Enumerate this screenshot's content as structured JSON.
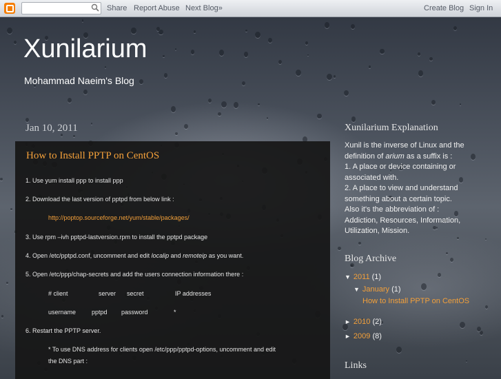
{
  "navbar": {
    "logo_icon": "blogger-logo-icon",
    "search_placeholder": "",
    "links": [
      "Share",
      "Report Abuse",
      "Next Blog»"
    ],
    "right_links": [
      "Create Blog",
      "Sign In"
    ]
  },
  "header": {
    "title": "Xunilarium",
    "description": "Mohammad Naeim's Blog"
  },
  "post": {
    "date": "Jan 10, 2011",
    "title": "How to Install PPTP on CentOS",
    "lines": {
      "l1": "1. Use  yum install ppp to install ppp",
      "l2": "2. Download the last version of pptpd  from below link :",
      "link": "http://poptop.sourceforge.net/yum/stable/packages/",
      "l3": "3. Use rpm –ivh pptpd-lastversion.rpm to install the pptpd package",
      "l4a": "4. Open /etc/pptpd.conf, uncomment and edit ",
      "l4b": "localip",
      "l4c": " and ",
      "l4d": "remoteip",
      "l4e": " as you want.",
      "l5": "5. Open /etc/ppp/chap-secrets and add the users connection information there :",
      "table_head": [
        "# client",
        "server",
        "secret",
        "IP addresses"
      ],
      "table_row": [
        "username",
        "pptpd",
        "password",
        "*"
      ],
      "l6": "6. Restart the PPTP server.",
      "l7a": "* To use DNS address for clients open /etc/ppp/pptpd-options, uncomment and edit",
      "l7b": "the DNS part :"
    }
  },
  "sidebar": {
    "explanation_title": "Xunilarium Explanation",
    "explanation_p1a": "Xunil is the inverse of Linux and the definition of ",
    "explanation_p1b": "arium",
    "explanation_p1c": " as a suffix is :",
    "explanation_lines": [
      "1. A place or device containing or associated with.",
      "2. A place to view and understand something about a certain topic.",
      "Also it's the abbreviation of :",
      "Addiction, Resources, Information, Utilization, Mission."
    ],
    "archive_title": "Blog Archive",
    "archive": {
      "y2011": "2011",
      "y2011_count": "(1)",
      "jan": "January",
      "jan_count": "(1)",
      "post": "How to Install PPTP on CentOS",
      "y2010": "2010",
      "y2010_count": "(2)",
      "y2009": "2009",
      "y2009_count": "(8)"
    },
    "links_title": "Links"
  },
  "colors": {
    "accent": "#f3a03a",
    "post_bg": "#161616",
    "text": "#e6e6e6"
  }
}
